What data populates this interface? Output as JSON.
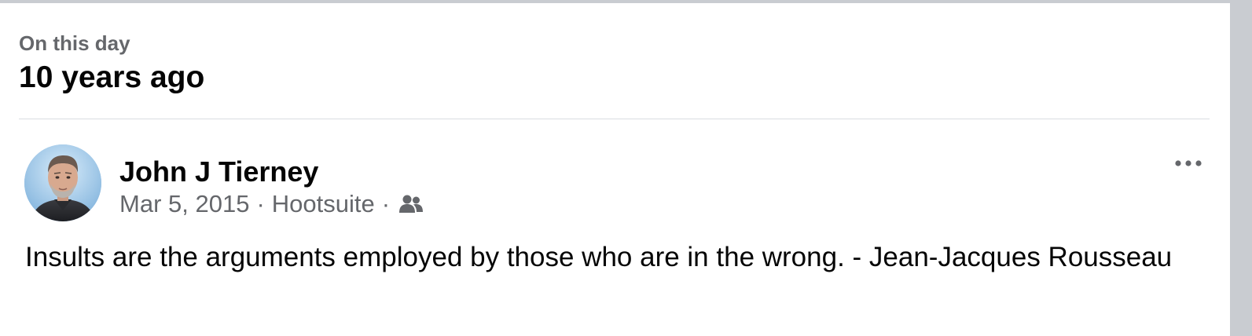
{
  "memory": {
    "label": "On this day",
    "title": "10 years ago"
  },
  "post": {
    "author": "John J Tierney",
    "date": "Mar 5, 2015",
    "separator": "·",
    "source": "Hootsuite",
    "audience_icon": "friends-icon",
    "more_icon": "more-options-icon",
    "text": "Insults are the arguments employed by those who are in the wrong. - Jean-Jacques Rousseau"
  },
  "colors": {
    "primary_text": "#050505",
    "secondary_text": "#65676b",
    "divider": "#dadde1",
    "background": "#ffffff",
    "frame": "#c9ccd1"
  }
}
